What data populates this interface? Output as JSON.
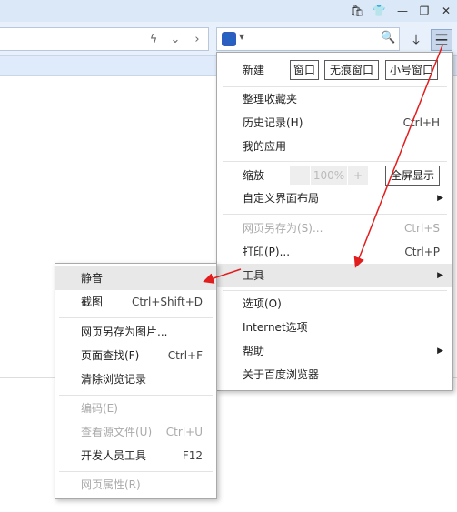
{
  "main_menu": {
    "new_label": "新建",
    "new_window": "窗口",
    "incognito_window": "无痕窗口",
    "small_window": "小号窗口",
    "organize_favorites": "整理收藏夹",
    "history": "历史记录(H)",
    "history_shortcut": "Ctrl+H",
    "my_apps": "我的应用",
    "zoom_label": "缩放",
    "zoom_minus": "-",
    "zoom_value": "100%",
    "zoom_plus": "+",
    "fullscreen": "全屏显示",
    "customize_layout": "自定义界面布局",
    "save_page_as": "网页另存为(S)...",
    "save_page_as_shortcut": "Ctrl+S",
    "print": "打印(P)...",
    "print_shortcut": "Ctrl+P",
    "tools": "工具",
    "options": "选项(O)",
    "internet_options": "Internet选项",
    "help": "帮助",
    "about": "关于百度浏览器"
  },
  "tools_submenu": {
    "mute": "静音",
    "screenshot": "截图",
    "screenshot_shortcut": "Ctrl+Shift+D",
    "save_as_image": "网页另存为图片...",
    "find_in_page": "页面查找(F)",
    "find_in_page_shortcut": "Ctrl+F",
    "clear_history": "清除浏览记录",
    "encoding": "编码(E)",
    "view_source": "查看源文件(U)",
    "view_source_shortcut": "Ctrl+U",
    "dev_tools": "开发人员工具",
    "dev_tools_shortcut": "F12",
    "page_properties": "网页属性(R)"
  },
  "icons": {
    "paw": "baidu-paw-icon",
    "dropdown": "chevron-down-icon",
    "search": "search-icon",
    "download": "download-icon",
    "menu": "hamburger-menu-icon",
    "submenu_arrow": "triangle-right-icon"
  },
  "colors": {
    "annotation_arrow": "#e11d1d",
    "titlebar": "#dbe8f8",
    "toolbar": "#e8f0fb"
  }
}
